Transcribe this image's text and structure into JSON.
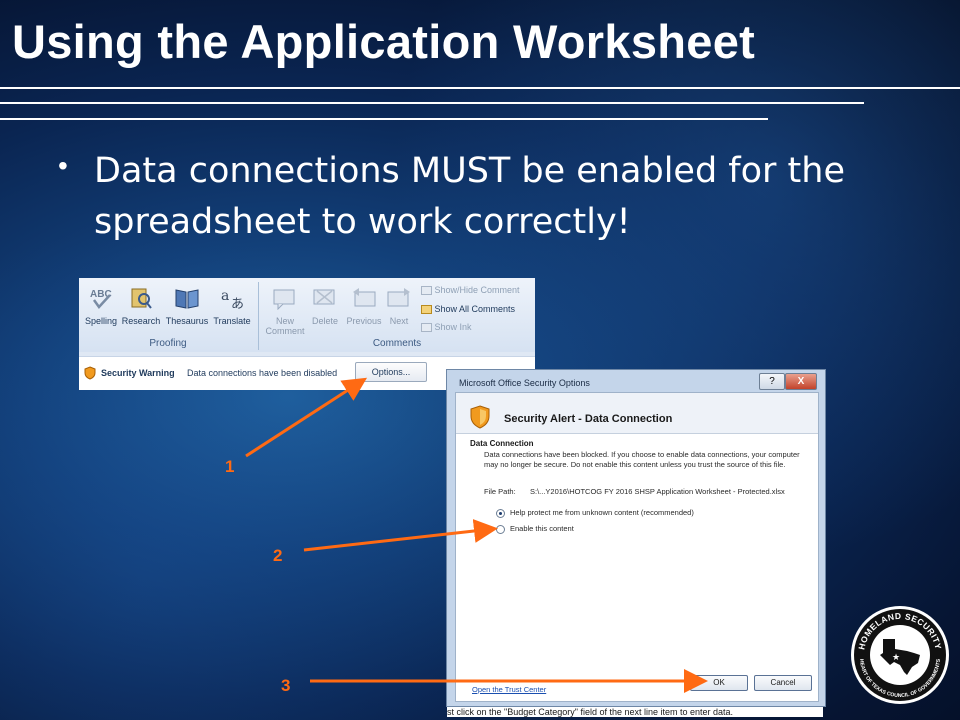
{
  "slide": {
    "title": "Using the Application Worksheet",
    "bullet": "Data connections MUST be enabled for the spreadsheet to work correctly!"
  },
  "ribbon": {
    "proofing": {
      "label": "Proofing",
      "buttons": [
        "Spelling",
        "Research",
        "Thesaurus",
        "Translate"
      ]
    },
    "comments": {
      "label": "Comments",
      "new_comment": "New Comment",
      "delete": "Delete",
      "previous": "Previous",
      "next": "Next",
      "show_hide": "Show/Hide Comment",
      "show_all": "Show All Comments",
      "show_ink": "Show Ink"
    },
    "security_warning": {
      "title": "Security Warning",
      "text": "Data connections have been disabled",
      "options_button": "Options..."
    }
  },
  "dialog": {
    "window_title": "Microsoft Office Security Options",
    "help_button": "?",
    "close_button": "X",
    "alert_title": "Security Alert - Data Connection",
    "section_title": "Data Connection",
    "section_body": "Data connections have been blocked. If you choose to enable data connections, your computer may no longer be secure. Do not enable this content unless you trust the source of this file.",
    "file_path_label": "File Path:",
    "file_path_value": "S:\\...Y2016\\HOTCOG FY 2016 SHSP Application Worksheet - Protected.xlsx",
    "options": [
      {
        "label": "Help protect me from unknown content (recommended)",
        "selected": true
      },
      {
        "label": "Enable this content",
        "selected": false
      }
    ],
    "trust_center_link": "Open the Trust Center",
    "ok_button": "OK",
    "cancel_button": "Cancel"
  },
  "callouts": [
    "1",
    "2",
    "3"
  ],
  "background_text": "st click on the \"Budget Category\" field of the next line item to enter data.",
  "logo": {
    "top_text": "HOMELAND SECURITY",
    "bottom_text": "HEART OF TEXAS COUNCIL OF GOVERNMENTS"
  },
  "colors": {
    "accent": "#ff6a13",
    "title": "#ffffff",
    "background": "#0a2552"
  }
}
